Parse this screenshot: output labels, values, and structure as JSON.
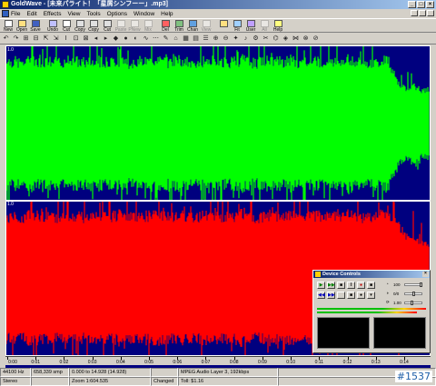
{
  "window": {
    "title": "GoldWave - [未来パライト！「星屑シンフーー」.mp3]"
  },
  "menu": [
    "File",
    "Edit",
    "Effects",
    "View",
    "Tools",
    "Options",
    "Window",
    "Help"
  ],
  "toolbar": [
    {
      "label": "New",
      "icon": "new-icon",
      "enabled": true
    },
    {
      "label": "Open",
      "icon": "open-icon",
      "enabled": true
    },
    {
      "label": "Save",
      "icon": "save-icon",
      "enabled": true
    },
    {
      "label": "Undo",
      "icon": "undo-icon",
      "enabled": true
    },
    {
      "label": "Cut",
      "icon": "cut-icon",
      "enabled": true
    },
    {
      "label": "Copy",
      "icon": "copy-icon",
      "enabled": true
    },
    {
      "label": "Copy",
      "icon": "copy2-icon",
      "enabled": true
    },
    {
      "label": "Cut",
      "icon": "trim-icon",
      "enabled": true
    },
    {
      "label": "Paste",
      "icon": "paste-icon",
      "enabled": false
    },
    {
      "label": "PNew",
      "icon": "paste-new-icon",
      "enabled": false
    },
    {
      "label": "Mix",
      "icon": "mix-icon",
      "enabled": false
    },
    {
      "label": "Del",
      "icon": "delete-icon",
      "enabled": true
    },
    {
      "label": "Trim",
      "icon": "trim2-icon",
      "enabled": true
    },
    {
      "label": "Chan",
      "icon": "channel-icon",
      "enabled": true
    },
    {
      "label": "View",
      "icon": "view-icon",
      "enabled": false
    },
    {
      "label": "",
      "icon": "zoom-icon",
      "enabled": true
    },
    {
      "label": "Fit",
      "icon": "fit-icon",
      "enabled": true
    },
    {
      "label": "User",
      "icon": "user-icon",
      "enabled": true
    },
    {
      "label": "All",
      "icon": "all-icon",
      "enabled": false
    },
    {
      "label": "Help",
      "icon": "help-icon",
      "enabled": true
    }
  ],
  "toolbar2_glyphs": [
    "↶",
    "↷",
    "⊞",
    "⊟",
    "⇱",
    "⇲",
    "I",
    "⊡",
    "⊠",
    "◂",
    "▸",
    "◆",
    "●",
    "◐",
    "∿",
    "⋯",
    "✎",
    "⌂",
    "▦",
    "▤",
    "☰",
    "⊕",
    "⊖",
    "✦",
    "♪",
    "⚙",
    "✂",
    "⌬",
    "◈",
    "⋈",
    "⊗",
    "⊘"
  ],
  "waveform": {
    "colors": {
      "background": "#00007f",
      "left_channel": "#00ff00",
      "right_channel": "#ff0000",
      "divider": "#ffffff"
    },
    "left_label": "1.0",
    "right_label": "1.0",
    "left_envelope": [
      0.86,
      0.88,
      0.85,
      0.9,
      0.87,
      0.89,
      0.86,
      0.88,
      0.9,
      0.87,
      0.86,
      0.89,
      0.88,
      0.87,
      0.9,
      0.86,
      0.88,
      0.87,
      0.89,
      0.88,
      0.86,
      0.9,
      0.87,
      0.85,
      0.88,
      0.89,
      0.87,
      0.86,
      0.88,
      0.9,
      0.87,
      0.86,
      0.89,
      0.88,
      0.87,
      0.9,
      0.86,
      0.88,
      0.87,
      0.89,
      0.88,
      0.86,
      0.9,
      0.87,
      0.85,
      0.88,
      0.89,
      0.87,
      0.6,
      0.5,
      0.55,
      0.45,
      0.5
    ],
    "right_envelope": [
      0.86,
      0.88,
      0.85,
      0.9,
      0.87,
      0.89,
      0.86,
      0.88,
      0.9,
      0.87,
      0.86,
      0.89,
      0.88,
      0.87,
      0.9,
      0.86,
      0.88,
      0.87,
      0.89,
      0.88,
      0.86,
      0.9,
      0.87,
      0.85,
      0.88,
      0.89,
      0.87,
      0.86,
      0.88,
      0.9,
      0.87,
      0.86,
      0.89,
      0.88,
      0.87,
      0.9,
      0.86,
      0.88,
      0.87,
      0.89,
      0.88,
      0.86,
      0.9,
      0.87,
      0.85,
      0.88,
      0.89,
      0.87,
      0.8,
      0.6,
      0.55,
      0.5,
      0.45
    ]
  },
  "ruler": {
    "labels": [
      "0:00",
      "0:01",
      "0:02",
      "0:03",
      "0:04",
      "0:05",
      "0:06",
      "0:07",
      "0:08",
      "0:09",
      "0:10",
      "0:11",
      "0:12",
      "0:13",
      "0:14"
    ]
  },
  "status": {
    "row1": [
      "44100 Hz",
      "658,339 smp",
      "0.000 to 14.928 (14.928)",
      "",
      "MPEG Audio Layer 3, 192kbps",
      ""
    ],
    "row2": [
      "Stereo",
      "",
      "Zoom 1:604.535",
      "Changed",
      "Toll: $1.16",
      ""
    ]
  },
  "device_controls": {
    "title": "Device Controls",
    "volume": "100",
    "balance": "0/0",
    "speed": "1.00",
    "buttons_row1": [
      "▶",
      "▶▶",
      "■",
      "‖",
      "●",
      "■"
    ],
    "buttons_row2": [
      "◀◀",
      "▶▶",
      "",
      "■",
      "●",
      "▾"
    ]
  },
  "badge": "#1537"
}
